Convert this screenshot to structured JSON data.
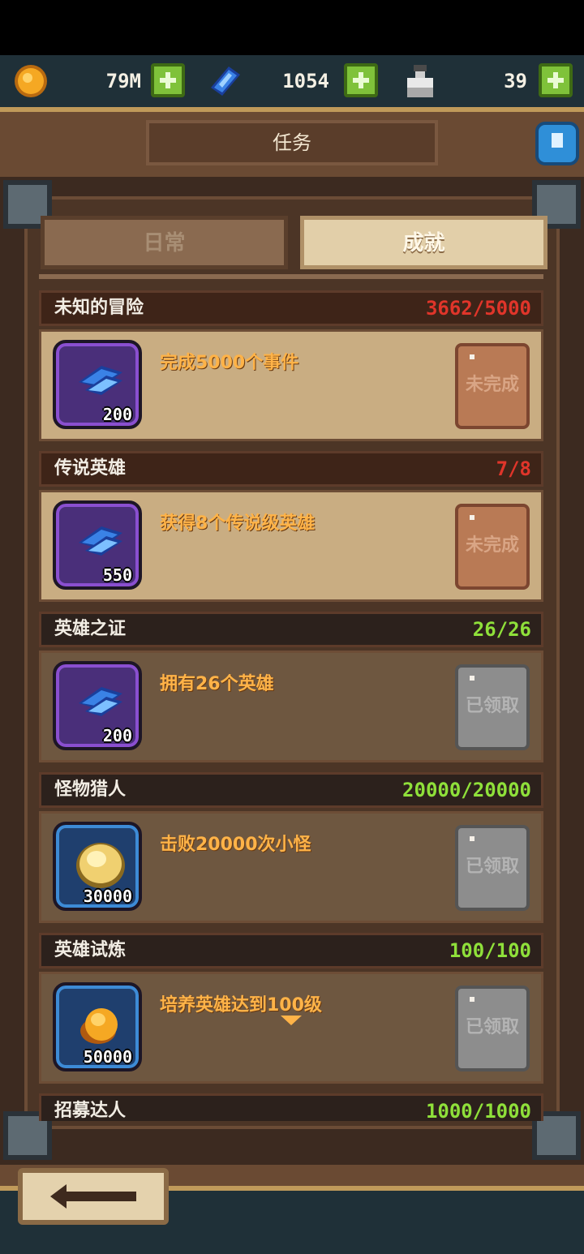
{
  "resources": {
    "gold": {
      "icon": "gold-coin-icon",
      "value": "79M"
    },
    "gems": {
      "icon": "blue-gem-icon",
      "value": "1054"
    },
    "potion": {
      "icon": "potion-bottle-icon",
      "value": "39"
    }
  },
  "header": {
    "title": "任务",
    "help_icon": "help-icon"
  },
  "tabs": [
    {
      "label": "日常",
      "active": false
    },
    {
      "label": "成就",
      "active": true
    }
  ],
  "achievements": [
    {
      "title": "未知的冒险",
      "progress": "3662/5000",
      "desc": "完成5000个事件",
      "reward_type": "gem",
      "reward_amount": "200",
      "status": "未完成"
    },
    {
      "title": "传说英雄",
      "progress": "7/8",
      "desc": "获得8个传说级英雄",
      "reward_type": "gem",
      "reward_amount": "550",
      "status": "未完成"
    },
    {
      "title": "英雄之证",
      "progress": "26/26",
      "desc": "拥有26个英雄",
      "reward_type": "gem",
      "reward_amount": "200",
      "status": "已领取"
    },
    {
      "title": "怪物猎人",
      "progress": "20000/20000",
      "desc": "击败20000次小怪",
      "reward_type": "gold",
      "reward_amount": "30000",
      "status": "已领取"
    },
    {
      "title": "英雄试炼",
      "progress": "100/100",
      "desc": "培养英雄达到100级",
      "reward_type": "gold",
      "reward_amount": "50000",
      "status": "已领取"
    },
    {
      "title": "招募达人",
      "progress": "1000/1000"
    }
  ],
  "colors": {
    "incomplete_progress": "#e0352a",
    "complete_progress": "#8fe03a",
    "accent_text": "#ffb348"
  },
  "footer": {
    "back_icon": "back-arrow-icon"
  }
}
